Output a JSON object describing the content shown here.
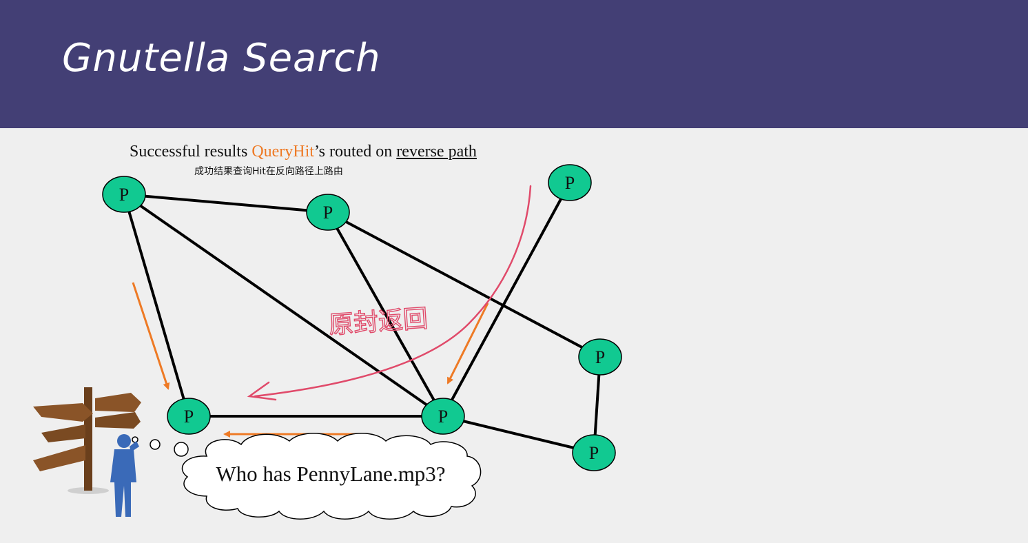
{
  "slide": {
    "title": "Gnutella Search",
    "caption": {
      "prefix": "Successful results ",
      "highlight": "QueryHit",
      "middle": "’s routed on ",
      "underlined": "reverse path"
    },
    "subcaption": "成功结果查询Hit在反向路径上路由",
    "handwritten_note": "原封返回"
  },
  "diagram": {
    "node_label": "P",
    "query_bubble": "Who has PennyLane.mp3?",
    "colors": {
      "header": "#433f75",
      "node_fill": "#11c991",
      "orange_arrow": "#ee7a25",
      "red_annotation": "#e04a6a",
      "figure": "#3a6ab8",
      "signpost": "#7a4a22"
    }
  }
}
